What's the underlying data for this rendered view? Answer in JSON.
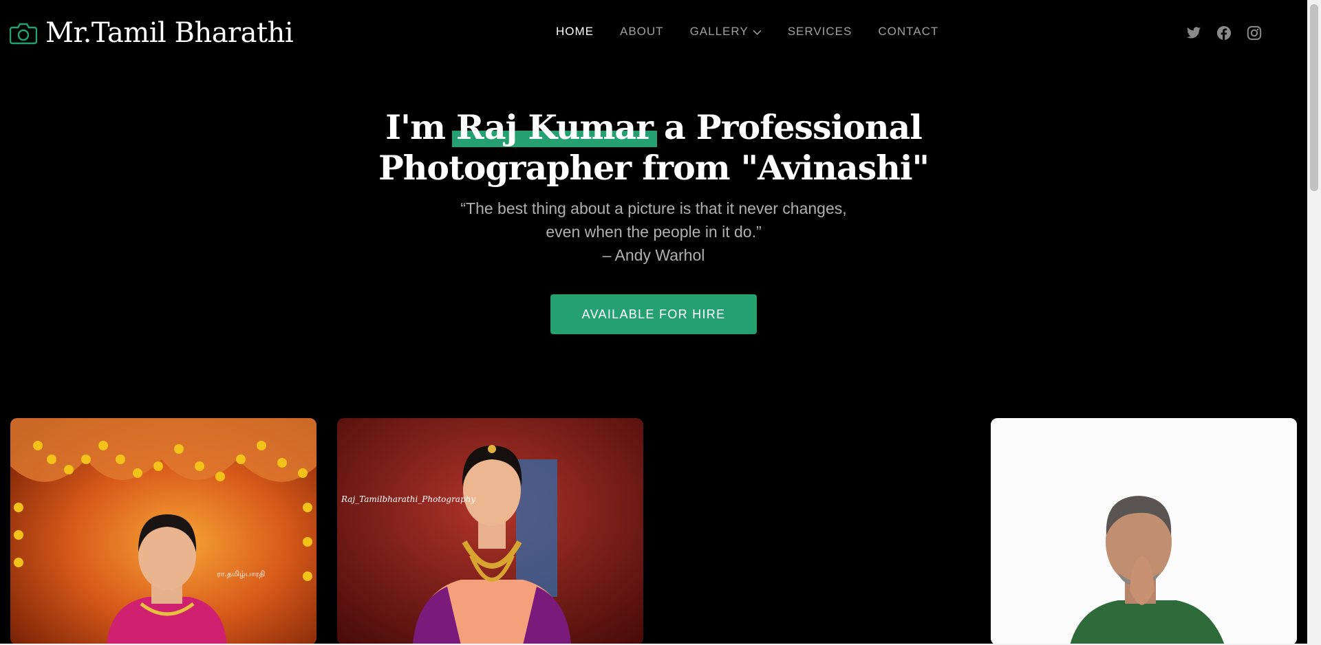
{
  "brand": {
    "name": "Mr.Tamil Bharathi",
    "icon": "camera-icon",
    "accent": "#24a071"
  },
  "nav": [
    {
      "label": "HOME",
      "active": true
    },
    {
      "label": "ABOUT"
    },
    {
      "label": "GALLERY",
      "has_dropdown": true
    },
    {
      "label": "SERVICES"
    },
    {
      "label": "CONTACT"
    }
  ],
  "socials": [
    "twitter-icon",
    "facebook-icon",
    "instagram-icon"
  ],
  "hero": {
    "title_prefix": "I'm",
    "title_name": "Raj Kumar",
    "title_suffix": "a Professional",
    "title_line2": "Photographer from \"Avinashi\"",
    "quote_line1": "“The best thing about a picture is that it never changes,",
    "quote_line2": "even when the people in it do.”",
    "quote_author": "– Andy Warhol",
    "cta_label": "AVAILABLE FOR HIRE"
  },
  "gallery": {
    "photos": [
      {
        "watermark": "ரா.தமிழ்பாரதி"
      },
      {
        "watermark": "Raj_Tamilbharathi_Photography"
      },
      {}
    ]
  }
}
